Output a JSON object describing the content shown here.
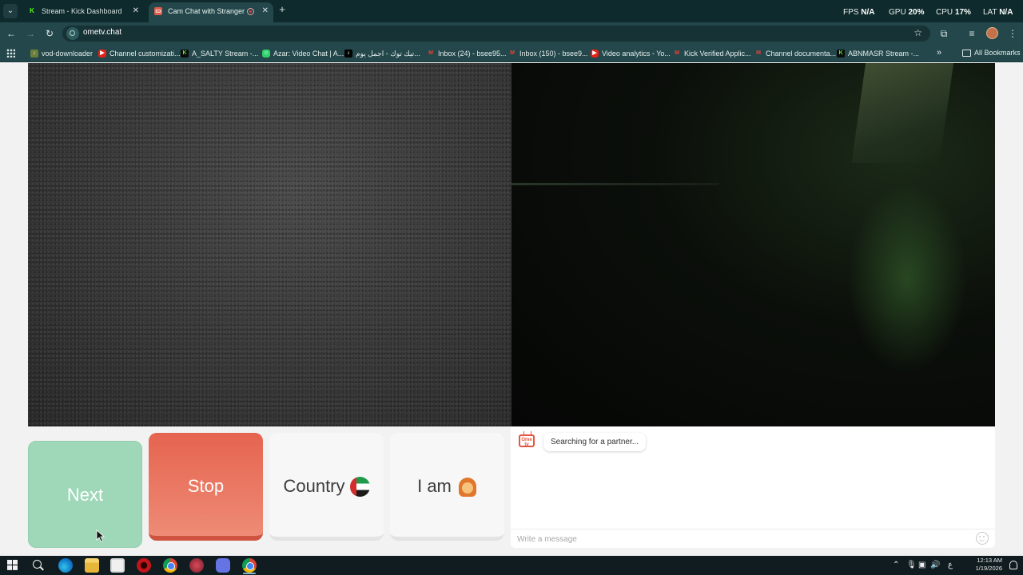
{
  "browser": {
    "tabs": [
      {
        "title": "Stream - Kick Dashboard",
        "active": false,
        "favicon": "kick-icon"
      },
      {
        "title": "Cam Chat with Strangers on",
        "active": true,
        "favicon": "ometv-icon"
      }
    ],
    "url": "ometv.chat",
    "stats": {
      "fps_label": "FPS",
      "fps_value": "N/A",
      "gpu_label": "GPU",
      "gpu_value": "20",
      "cpu_label": "CPU",
      "cpu_value": "17",
      "lat_label": "LAT",
      "lat_value": "N/A",
      "percent": "%"
    },
    "bookmarks": [
      {
        "label": "vod-downloader",
        "icon": "download-icon"
      },
      {
        "label": "Channel customizati...",
        "icon": "youtube-icon"
      },
      {
        "label": "A_SALTY Stream -...",
        "icon": "kick-icon"
      },
      {
        "label": "Azar: Video Chat | A...",
        "icon": "azar-icon"
      },
      {
        "label": "تيك توك - اجمل يوم...",
        "icon": "tiktok-icon"
      },
      {
        "label": "Inbox (24) - bsee95...",
        "icon": "gmail-icon"
      },
      {
        "label": "Inbox (150) - bsee9...",
        "icon": "gmail-icon"
      },
      {
        "label": "Video analytics - Yo...",
        "icon": "youtube-icon"
      },
      {
        "label": "Kick Verified Applic...",
        "icon": "gmail-icon"
      },
      {
        "label": "Channel documenta...",
        "icon": "gmail-icon"
      },
      {
        "label": "ABNMASR Stream -...",
        "icon": "kick-icon"
      }
    ],
    "all_bookmarks": "All Bookmarks"
  },
  "page": {
    "buttons": {
      "next": "Next",
      "stop": "Stop",
      "country": "Country",
      "iam": "I am"
    },
    "chat": {
      "status": "Searching for a partner...",
      "placeholder": "Write a message"
    }
  },
  "taskbar": {
    "lang": "ع",
    "time": "12:13 AM",
    "date": "1/19/2026"
  },
  "colors": {
    "next": "#9fd8b9",
    "stop": "#e8694f",
    "accent": "#e6553f"
  }
}
